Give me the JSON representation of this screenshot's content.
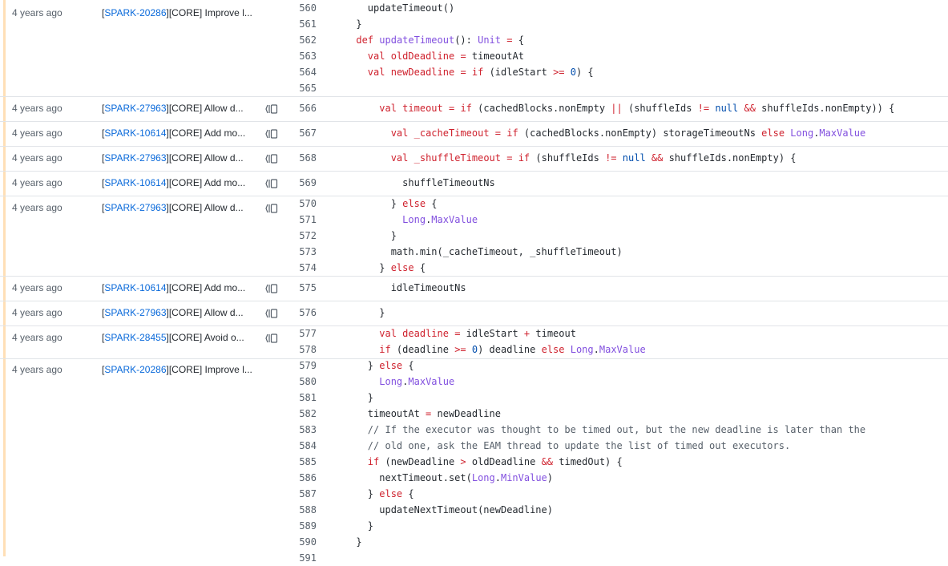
{
  "blocks": [
    {
      "age": "4 years ago",
      "ticket": "SPARK-20286",
      "rest": "][CORE] Improve l...",
      "reblame": false
    },
    {
      "age": "4 years ago",
      "ticket": "SPARK-27963",
      "rest": "][CORE] Allow d...",
      "reblame": true
    },
    {
      "age": "4 years ago",
      "ticket": "SPARK-10614",
      "rest": "][CORE] Add mo...",
      "reblame": true
    },
    {
      "age": "4 years ago",
      "ticket": "SPARK-27963",
      "rest": "][CORE] Allow d...",
      "reblame": true
    },
    {
      "age": "4 years ago",
      "ticket": "SPARK-10614",
      "rest": "][CORE] Add mo...",
      "reblame": true
    },
    {
      "age": "4 years ago",
      "ticket": "SPARK-27963",
      "rest": "][CORE] Allow d...",
      "reblame": true
    },
    {
      "age": "4 years ago",
      "ticket": "SPARK-10614",
      "rest": "][CORE] Add mo...",
      "reblame": true
    },
    {
      "age": "4 years ago",
      "ticket": "SPARK-27963",
      "rest": "][CORE] Allow d...",
      "reblame": true
    },
    {
      "age": "4 years ago",
      "ticket": "SPARK-28455",
      "rest": "][CORE] Avoid o...",
      "reblame": true
    },
    {
      "age": "4 years ago",
      "ticket": "SPARK-20286",
      "rest": "][CORE] Improve l...",
      "reblame": false
    }
  ],
  "lines": [
    {
      "n": "560",
      "t": [
        [
          "",
          "        updateTimeout()"
        ]
      ]
    },
    {
      "n": "561",
      "t": [
        [
          "",
          "      }"
        ]
      ]
    },
    {
      "n": "562",
      "t": [
        [
          "",
          "      "
        ],
        [
          "kw",
          "def"
        ],
        [
          "",
          " "
        ],
        [
          "fn",
          "updateTimeout"
        ],
        [
          "",
          "(): "
        ],
        [
          "ty",
          "Unit"
        ],
        [
          "",
          " "
        ],
        [
          "kw",
          "="
        ],
        [
          "",
          " {"
        ]
      ]
    },
    {
      "n": "563",
      "t": [
        [
          "",
          "        "
        ],
        [
          "kw",
          "val"
        ],
        [
          "",
          " "
        ],
        [
          "kw",
          "oldDeadline"
        ],
        [
          "",
          " "
        ],
        [
          "kw",
          "="
        ],
        [
          "",
          " timeoutAt"
        ]
      ]
    },
    {
      "n": "564",
      "t": [
        [
          "",
          "        "
        ],
        [
          "kw",
          "val"
        ],
        [
          "",
          " "
        ],
        [
          "kw",
          "newDeadline"
        ],
        [
          "",
          " "
        ],
        [
          "kw",
          "="
        ],
        [
          "",
          " "
        ],
        [
          "kw",
          "if"
        ],
        [
          "",
          " (idleStart "
        ],
        [
          "kw",
          ">="
        ],
        [
          "",
          " "
        ],
        [
          "num",
          "0"
        ],
        [
          "",
          ") {"
        ]
      ]
    },
    {
      "n": "565",
      "t": [
        [
          "",
          ""
        ]
      ]
    },
    {
      "n": "566",
      "t": [
        [
          "",
          "          "
        ],
        [
          "kw",
          "val"
        ],
        [
          "",
          " "
        ],
        [
          "kw",
          "timeout"
        ],
        [
          "",
          " "
        ],
        [
          "kw",
          "="
        ],
        [
          "",
          " "
        ],
        [
          "kw",
          "if"
        ],
        [
          "",
          " (cachedBlocks.nonEmpty "
        ],
        [
          "kw",
          "||"
        ],
        [
          "",
          " (shuffleIds "
        ],
        [
          "kw",
          "!="
        ],
        [
          "",
          " "
        ],
        [
          "nu",
          "null"
        ],
        [
          "",
          " "
        ],
        [
          "kw",
          "&&"
        ],
        [
          "",
          " shuffleIds.nonEmpty)) {"
        ]
      ]
    },
    {
      "n": "567",
      "t": [
        [
          "",
          "            "
        ],
        [
          "kw",
          "val"
        ],
        [
          "",
          " "
        ],
        [
          "kw",
          "_cacheTimeout"
        ],
        [
          "",
          " "
        ],
        [
          "kw",
          "="
        ],
        [
          "",
          " "
        ],
        [
          "kw",
          "if"
        ],
        [
          "",
          " (cachedBlocks.nonEmpty) storageTimeoutNs "
        ],
        [
          "kw",
          "else"
        ],
        [
          "",
          " "
        ],
        [
          "ty",
          "Long"
        ],
        [
          "",
          "."
        ],
        [
          "ty",
          "MaxValue"
        ]
      ]
    },
    {
      "n": "568",
      "t": [
        [
          "",
          "            "
        ],
        [
          "kw",
          "val"
        ],
        [
          "",
          " "
        ],
        [
          "kw",
          "_shuffleTimeout"
        ],
        [
          "",
          " "
        ],
        [
          "kw",
          "="
        ],
        [
          "",
          " "
        ],
        [
          "kw",
          "if"
        ],
        [
          "",
          " (shuffleIds "
        ],
        [
          "kw",
          "!="
        ],
        [
          "",
          " "
        ],
        [
          "nu",
          "null"
        ],
        [
          "",
          " "
        ],
        [
          "kw",
          "&&"
        ],
        [
          "",
          " shuffleIds.nonEmpty) {"
        ]
      ]
    },
    {
      "n": "569",
      "t": [
        [
          "",
          "              shuffleTimeoutNs"
        ]
      ]
    },
    {
      "n": "570",
      "t": [
        [
          "",
          "            } "
        ],
        [
          "kw",
          "else"
        ],
        [
          "",
          " {"
        ]
      ]
    },
    {
      "n": "571",
      "t": [
        [
          "",
          "              "
        ],
        [
          "ty",
          "Long"
        ],
        [
          "",
          "."
        ],
        [
          "ty",
          "MaxValue"
        ]
      ]
    },
    {
      "n": "572",
      "t": [
        [
          "",
          "            }"
        ]
      ]
    },
    {
      "n": "573",
      "t": [
        [
          "",
          "            math.min(_cacheTimeout, _shuffleTimeout)"
        ]
      ]
    },
    {
      "n": "574",
      "t": [
        [
          "",
          "          } "
        ],
        [
          "kw",
          "else"
        ],
        [
          "",
          " {"
        ]
      ]
    },
    {
      "n": "575",
      "t": [
        [
          "",
          "            idleTimeoutNs"
        ]
      ]
    },
    {
      "n": "576",
      "t": [
        [
          "",
          "          }"
        ]
      ]
    },
    {
      "n": "577",
      "t": [
        [
          "",
          "          "
        ],
        [
          "kw",
          "val"
        ],
        [
          "",
          " "
        ],
        [
          "kw",
          "deadline"
        ],
        [
          "",
          " "
        ],
        [
          "kw",
          "="
        ],
        [
          "",
          " idleStart "
        ],
        [
          "kw",
          "+"
        ],
        [
          "",
          " timeout"
        ]
      ]
    },
    {
      "n": "578",
      "t": [
        [
          "",
          "          "
        ],
        [
          "kw",
          "if"
        ],
        [
          "",
          " (deadline "
        ],
        [
          "kw",
          ">="
        ],
        [
          "",
          " "
        ],
        [
          "num",
          "0"
        ],
        [
          "",
          ") deadline "
        ],
        [
          "kw",
          "else"
        ],
        [
          "",
          " "
        ],
        [
          "ty",
          "Long"
        ],
        [
          "",
          "."
        ],
        [
          "ty",
          "MaxValue"
        ]
      ]
    },
    {
      "n": "579",
      "t": [
        [
          "",
          "        } "
        ],
        [
          "kw",
          "else"
        ],
        [
          "",
          " {"
        ]
      ]
    },
    {
      "n": "580",
      "t": [
        [
          "",
          "          "
        ],
        [
          "ty",
          "Long"
        ],
        [
          "",
          "."
        ],
        [
          "ty",
          "MaxValue"
        ]
      ]
    },
    {
      "n": "581",
      "t": [
        [
          "",
          "        }"
        ]
      ]
    },
    {
      "n": "582",
      "t": [
        [
          "",
          "        timeoutAt "
        ],
        [
          "kw",
          "="
        ],
        [
          "",
          " newDeadline"
        ]
      ]
    },
    {
      "n": "583",
      "t": [
        [
          "",
          "        "
        ],
        [
          "cm",
          "// If the executor was thought to be timed out, but the new deadline is later than the"
        ]
      ]
    },
    {
      "n": "584",
      "t": [
        [
          "",
          "        "
        ],
        [
          "cm",
          "// old one, ask the EAM thread to update the list of timed out executors."
        ]
      ]
    },
    {
      "n": "585",
      "t": [
        [
          "",
          "        "
        ],
        [
          "kw",
          "if"
        ],
        [
          "",
          " (newDeadline "
        ],
        [
          "kw",
          ">"
        ],
        [
          "",
          " oldDeadline "
        ],
        [
          "kw",
          "&&"
        ],
        [
          "",
          " timedOut) {"
        ]
      ]
    },
    {
      "n": "586",
      "t": [
        [
          "",
          "          nextTimeout.set("
        ],
        [
          "ty",
          "Long"
        ],
        [
          "",
          "."
        ],
        [
          "ty",
          "MinValue"
        ],
        [
          "",
          ")"
        ]
      ]
    },
    {
      "n": "587",
      "t": [
        [
          "",
          "        } "
        ],
        [
          "kw",
          "else"
        ],
        [
          "",
          " {"
        ]
      ]
    },
    {
      "n": "588",
      "t": [
        [
          "",
          "          updateNextTimeout(newDeadline)"
        ]
      ]
    },
    {
      "n": "589",
      "t": [
        [
          "",
          "        }"
        ]
      ]
    },
    {
      "n": "590",
      "t": [
        [
          "",
          "      }"
        ]
      ]
    },
    {
      "n": "591",
      "t": [
        [
          "",
          ""
        ]
      ]
    }
  ]
}
